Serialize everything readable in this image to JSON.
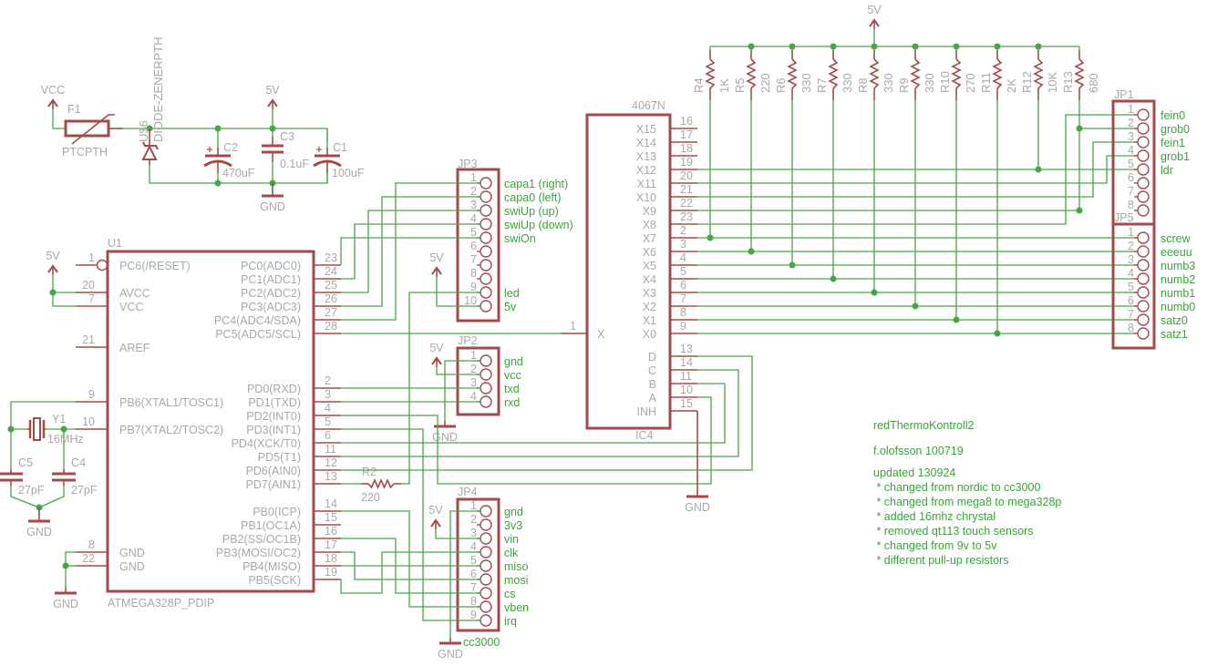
{
  "power": {
    "vcc": "VCC",
    "supply_5v": "5V",
    "gnd": "GND",
    "f1": {
      "ref": "F1",
      "value": "PTCPTH"
    },
    "u6": {
      "ref": "U$6",
      "value": "DIODE-ZENERPTH"
    },
    "c2": {
      "ref": "C2",
      "value": "470uF"
    },
    "c3": {
      "ref": "C3",
      "value": "0.1uF"
    },
    "c1": {
      "ref": "C1",
      "value": "100uF"
    }
  },
  "crystal": {
    "y1": {
      "ref": "Y1",
      "value": "16MHz"
    },
    "c5": {
      "ref": "C5",
      "value": "27pF"
    },
    "c4": {
      "ref": "C4",
      "value": "27pF"
    }
  },
  "u1": {
    "ref": "U1",
    "part": "ATMEGA328P_PDIP",
    "left_pins": [
      {
        "num": "1",
        "label": "PC6(/RESET)"
      },
      {
        "num": "20",
        "label": "AVCC"
      },
      {
        "num": "7",
        "label": "VCC"
      },
      {
        "num": "21",
        "label": "AREF"
      },
      {
        "num": "9",
        "label": "PB6(XTAL1/TOSC1)"
      },
      {
        "num": "10",
        "label": "PB7(XTAL2/TOSC2)"
      },
      {
        "num": "8",
        "label": "GND"
      },
      {
        "num": "22",
        "label": "GND"
      }
    ],
    "right_pins": [
      {
        "num": "23",
        "label": "PC0(ADC0)"
      },
      {
        "num": "24",
        "label": "PC1(ADC1)"
      },
      {
        "num": "25",
        "label": "PC2(ADC2)"
      },
      {
        "num": "26",
        "label": "PC3(ADC3)"
      },
      {
        "num": "27",
        "label": "PC4(ADC4/SDA)"
      },
      {
        "num": "28",
        "label": "PC5(ADC5/SCL)"
      },
      {
        "num": "2",
        "label": "PD0(RXD)"
      },
      {
        "num": "3",
        "label": "PD1(TXD)"
      },
      {
        "num": "4",
        "label": "PD2(INT0)"
      },
      {
        "num": "5",
        "label": "PD3(INT1)"
      },
      {
        "num": "6",
        "label": "PD4(XCK/T0)"
      },
      {
        "num": "11",
        "label": "PD5(T1)"
      },
      {
        "num": "12",
        "label": "PD6(AIN0)"
      },
      {
        "num": "13",
        "label": "PD7(AIN1)"
      },
      {
        "num": "14",
        "label": "PB0(ICP)"
      },
      {
        "num": "15",
        "label": "PB1(OC1A)"
      },
      {
        "num": "16",
        "label": "PB2(SS/OC1B)"
      },
      {
        "num": "17",
        "label": "PB3(MOSI/OC2)"
      },
      {
        "num": "18",
        "label": "PB4(MISO)"
      },
      {
        "num": "19",
        "label": "PB5(SCK)"
      }
    ]
  },
  "r2": {
    "ref": "R2",
    "value": "220"
  },
  "jp3": {
    "ref": "JP3",
    "pins": [
      {
        "num": "1",
        "label": "capa1 (right)"
      },
      {
        "num": "2",
        "label": "capa0 (left)"
      },
      {
        "num": "3",
        "label": "swiUp (up)"
      },
      {
        "num": "4",
        "label": "swiUp (down)"
      },
      {
        "num": "5",
        "label": "swiOn"
      },
      {
        "num": "6",
        "label": ""
      },
      {
        "num": "7",
        "label": ""
      },
      {
        "num": "8",
        "label": ""
      },
      {
        "num": "9",
        "label": "led"
      },
      {
        "num": "10",
        "label": "5v"
      }
    ]
  },
  "jp2": {
    "ref": "JP2",
    "pins": [
      {
        "num": "1",
        "label": "gnd"
      },
      {
        "num": "2",
        "label": "vcc"
      },
      {
        "num": "3",
        "label": "txd"
      },
      {
        "num": "4",
        "label": "rxd"
      }
    ]
  },
  "jp4": {
    "ref": "JP4",
    "value": "cc3000",
    "pins": [
      {
        "num": "1",
        "label": "gnd"
      },
      {
        "num": "2",
        "label": "3v3"
      },
      {
        "num": "3",
        "label": "vin"
      },
      {
        "num": "4",
        "label": "clk"
      },
      {
        "num": "5",
        "label": "miso"
      },
      {
        "num": "6",
        "label": "mosi"
      },
      {
        "num": "7",
        "label": "cs"
      },
      {
        "num": "8",
        "label": "vben"
      },
      {
        "num": "9",
        "label": "irq"
      }
    ]
  },
  "ic4": {
    "ref": "IC4",
    "part": "4067N",
    "left_pins": [
      {
        "num": "1",
        "label": "X"
      }
    ],
    "right_pins": [
      {
        "num": "16",
        "label": "X15"
      },
      {
        "num": "17",
        "label": "X14"
      },
      {
        "num": "18",
        "label": "X13"
      },
      {
        "num": "19",
        "label": "X12"
      },
      {
        "num": "20",
        "label": "X11"
      },
      {
        "num": "21",
        "label": "X10"
      },
      {
        "num": "22",
        "label": "X9"
      },
      {
        "num": "23",
        "label": "X8"
      },
      {
        "num": "2",
        "label": "X7"
      },
      {
        "num": "3",
        "label": "X6"
      },
      {
        "num": "4",
        "label": "X5"
      },
      {
        "num": "5",
        "label": "X4"
      },
      {
        "num": "6",
        "label": "X3"
      },
      {
        "num": "7",
        "label": "X2"
      },
      {
        "num": "8",
        "label": "X1"
      },
      {
        "num": "9",
        "label": "X0"
      },
      {
        "num": "13",
        "label": "D"
      },
      {
        "num": "14",
        "label": "C"
      },
      {
        "num": "11",
        "label": "B"
      },
      {
        "num": "10",
        "label": "A"
      },
      {
        "num": "15",
        "label": "INH"
      }
    ]
  },
  "resistors": [
    {
      "ref": "R4",
      "value": "1K"
    },
    {
      "ref": "R5",
      "value": "220"
    },
    {
      "ref": "R6",
      "value": "330"
    },
    {
      "ref": "R7",
      "value": "330"
    },
    {
      "ref": "R8",
      "value": "330"
    },
    {
      "ref": "R9",
      "value": "330"
    },
    {
      "ref": "R10",
      "value": "270"
    },
    {
      "ref": "R11",
      "value": "2K"
    },
    {
      "ref": "R12",
      "value": "10K"
    },
    {
      "ref": "R13",
      "value": "680"
    }
  ],
  "jp1": {
    "ref": "JP1",
    "pins": [
      {
        "num": "1",
        "label": "fein0"
      },
      {
        "num": "2",
        "label": "grob0"
      },
      {
        "num": "3",
        "label": "fein1"
      },
      {
        "num": "4",
        "label": "grob1"
      },
      {
        "num": "5",
        "label": "ldr"
      },
      {
        "num": "6",
        "label": ""
      },
      {
        "num": "7",
        "label": ""
      },
      {
        "num": "8",
        "label": ""
      }
    ]
  },
  "jp5": {
    "ref": "JP5",
    "pins": [
      {
        "num": "1",
        "label": "screw"
      },
      {
        "num": "2",
        "label": "eeeuu"
      },
      {
        "num": "3",
        "label": "numb3"
      },
      {
        "num": "4",
        "label": "numb2"
      },
      {
        "num": "5",
        "label": "numb1"
      },
      {
        "num": "6",
        "label": "numb0"
      },
      {
        "num": "7",
        "label": "satz0"
      },
      {
        "num": "8",
        "label": "satz1"
      }
    ]
  },
  "notes": {
    "project": "redThermoKontroll2",
    "author": "f.olofsson 100719",
    "updated": "updated 130924",
    "changes": [
      " * changed from nordic to cc3000",
      " * changed from mega8 to mega328p",
      " * added 16mhz chrystal",
      " * removed qt113 touch sensors",
      " * changed from 9v to 5v",
      " * different pull-up resistors"
    ]
  },
  "colors": {
    "component": "#a54a4a",
    "wire": "#46a646",
    "text": "#a8a8a8",
    "net_label": "#3fa03f",
    "background": "#ffffff"
  }
}
